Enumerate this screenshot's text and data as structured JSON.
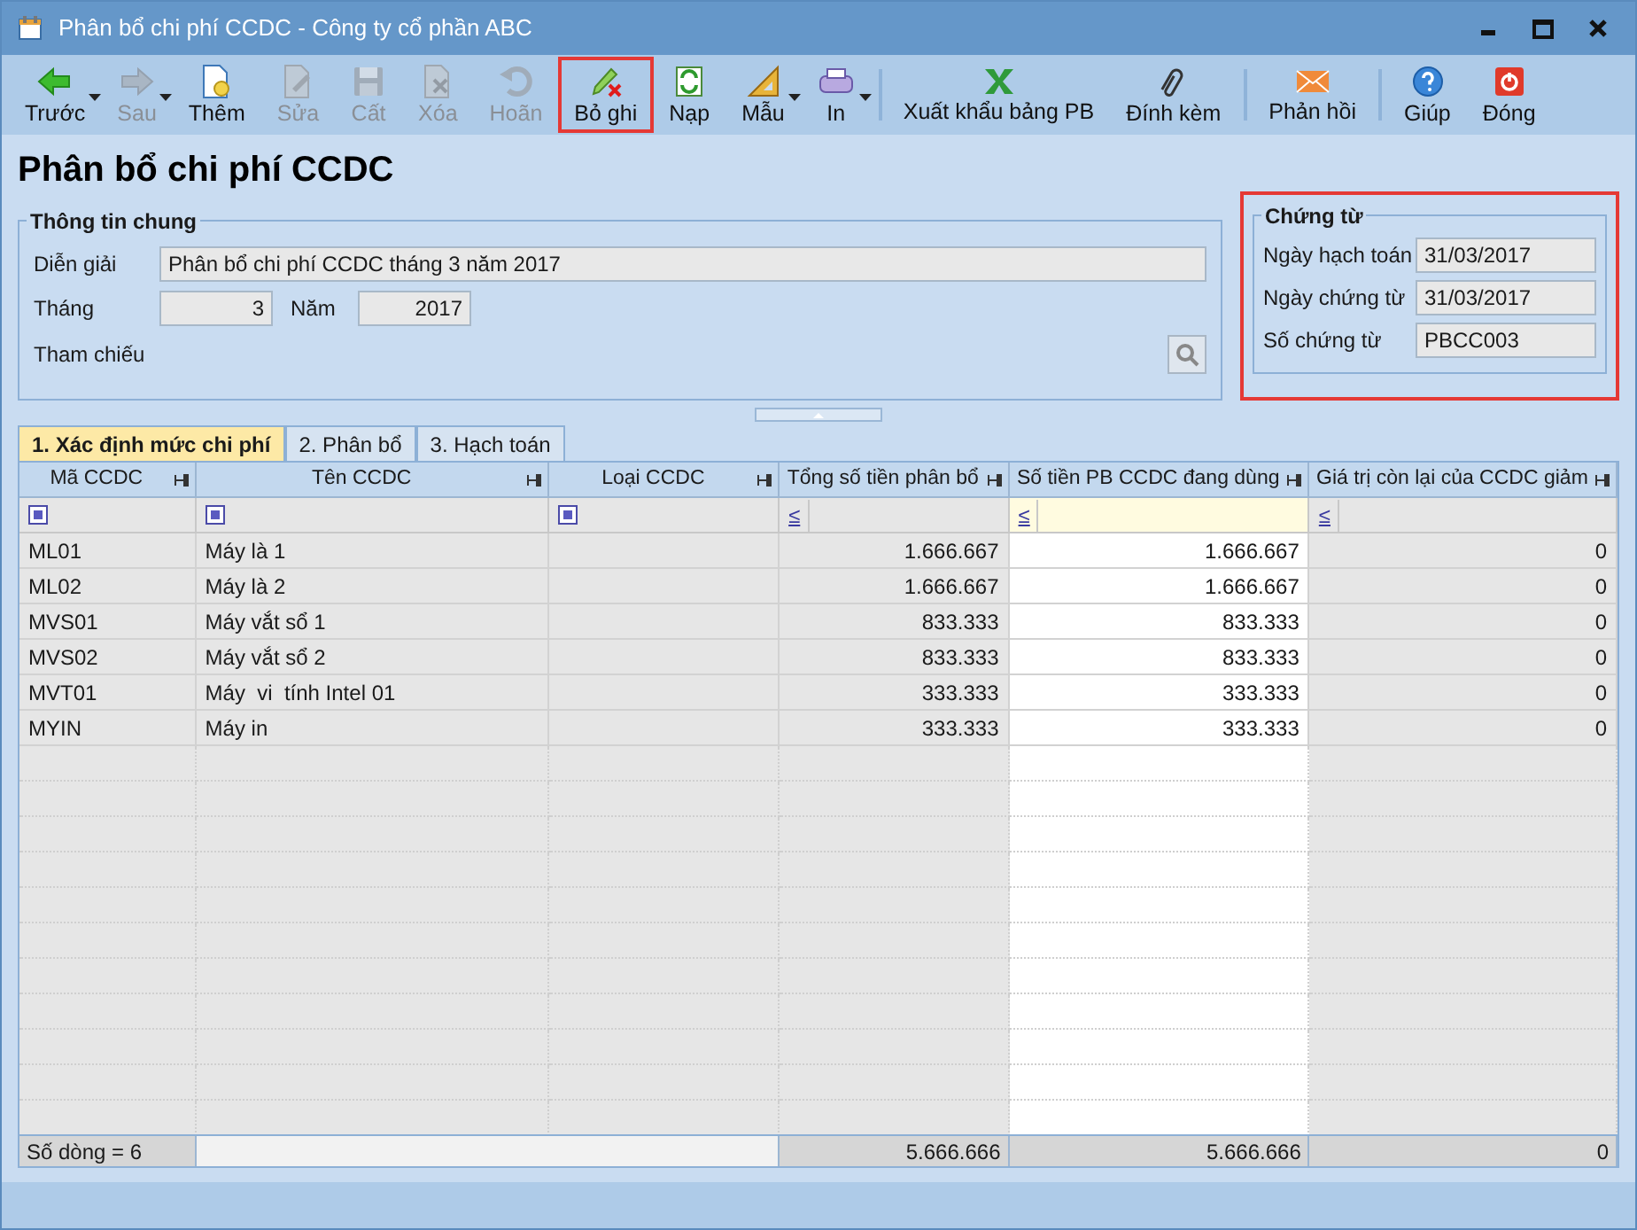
{
  "window": {
    "title": "Phân bổ chi phí CCDC - Công ty cổ phần ABC"
  },
  "toolbar": [
    {
      "label": "Trước",
      "disabled": false,
      "dropdown": true,
      "highlighted": false,
      "separator_before": false
    },
    {
      "label": "Sau",
      "disabled": true,
      "dropdown": true,
      "highlighted": false,
      "separator_before": false
    },
    {
      "label": "Thêm",
      "disabled": false,
      "dropdown": false,
      "highlighted": false,
      "separator_before": false
    },
    {
      "label": "Sửa",
      "disabled": true,
      "dropdown": false,
      "highlighted": false,
      "separator_before": false
    },
    {
      "label": "Cất",
      "disabled": true,
      "dropdown": false,
      "highlighted": false,
      "separator_before": false
    },
    {
      "label": "Xóa",
      "disabled": true,
      "dropdown": false,
      "highlighted": false,
      "separator_before": false
    },
    {
      "label": "Hoãn",
      "disabled": true,
      "dropdown": false,
      "highlighted": false,
      "separator_before": false
    },
    {
      "label": "Bỏ ghi",
      "disabled": false,
      "dropdown": false,
      "highlighted": true,
      "separator_before": false
    },
    {
      "label": "Nạp",
      "disabled": false,
      "dropdown": false,
      "highlighted": false,
      "separator_before": false
    },
    {
      "label": "Mẫu",
      "disabled": false,
      "dropdown": true,
      "highlighted": false,
      "separator_before": false
    },
    {
      "label": "In",
      "disabled": false,
      "dropdown": true,
      "highlighted": false,
      "separator_before": false
    },
    {
      "label": "Xuất khẩu bảng PB",
      "disabled": false,
      "dropdown": false,
      "highlighted": false,
      "separator_before": true
    },
    {
      "label": "Đính kèm",
      "disabled": false,
      "dropdown": false,
      "highlighted": false,
      "separator_before": false
    },
    {
      "label": "Phản hồi",
      "disabled": false,
      "dropdown": false,
      "highlighted": false,
      "separator_before": true
    },
    {
      "label": "Giúp",
      "disabled": false,
      "dropdown": false,
      "highlighted": false,
      "separator_before": true
    },
    {
      "label": "Đóng",
      "disabled": false,
      "dropdown": false,
      "highlighted": false,
      "separator_before": false
    }
  ],
  "page_title": "Phân bổ chi phí CCDC",
  "general": {
    "title": "Thông tin chung",
    "description_label": "Diễn giải",
    "description": "Phân bổ chi phí CCDC tháng 3 năm 2017",
    "month_label": "Tháng",
    "month": "3",
    "year_label": "Năm",
    "year": "2017",
    "reference_label": "Tham chiếu"
  },
  "voucher": {
    "title": "Chứng từ",
    "highlighted": true,
    "fields": [
      {
        "label": "Ngày hạch toán",
        "value": "31/03/2017"
      },
      {
        "label": "Ngày chứng từ",
        "value": "31/03/2017"
      },
      {
        "label": "Số chứng từ",
        "value": "PBCC003"
      }
    ]
  },
  "tabs": [
    {
      "label": "1. Xác định mức chi phí",
      "selected": true
    },
    {
      "label": "2. Phân bổ",
      "selected": false
    },
    {
      "label": "3. Hạch toán",
      "selected": false
    }
  ],
  "table": {
    "columns": [
      {
        "label": "Mã CCDC",
        "kind": "text",
        "editable": false
      },
      {
        "label": "Tên CCDC",
        "kind": "text",
        "editable": false
      },
      {
        "label": "Loại CCDC",
        "kind": "text",
        "editable": false
      },
      {
        "label": "Tổng số tiền phân bổ",
        "kind": "number",
        "filter": "≤",
        "editable": false
      },
      {
        "label": "Số tiền PB CCDC đang dùng",
        "kind": "number",
        "filter": "≤",
        "editable": true
      },
      {
        "label": "Giá trị còn lại của CCDC giảm",
        "kind": "number",
        "filter": "≤",
        "editable": false
      }
    ],
    "rows": [
      [
        "ML01",
        "Máy là 1",
        "",
        "1.666.667",
        "1.666.667",
        "0"
      ],
      [
        "ML02",
        "Máy là 2",
        "",
        "1.666.667",
        "1.666.667",
        "0"
      ],
      [
        "MVS01",
        "Máy vắt sổ 1",
        "",
        "833.333",
        "833.333",
        "0"
      ],
      [
        "MVS02",
        "Máy vắt sổ 2",
        "",
        "833.333",
        "833.333",
        "0"
      ],
      [
        "MVT01",
        "Máy  vi  tính Intel 01",
        "",
        "333.333",
        "333.333",
        "0"
      ],
      [
        "MYIN",
        "Máy in",
        "",
        "333.333",
        "333.333",
        "0"
      ]
    ],
    "footer": {
      "row_count": "Số dòng = 6",
      "totals": [
        "5.666.666",
        "5.666.666",
        "0"
      ]
    }
  }
}
